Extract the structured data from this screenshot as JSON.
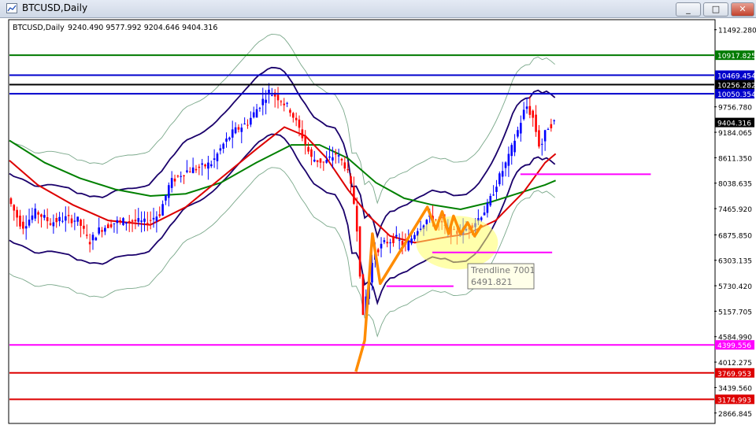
{
  "window": {
    "title": "BTCUSD,Daily",
    "buttons": [
      "_",
      "□",
      "✕"
    ]
  },
  "chart_data": {
    "type": "candlestick",
    "symbol_label": "BTCUSD,Daily",
    "ohlc_header": "9240.490 9577.992 9204.646 9404.316",
    "ohlc": {
      "open": 9240.49,
      "high": 9577.992,
      "low": 9204.646,
      "close": 9404.316
    },
    "last_price": 9404.316,
    "ylim": [
      2650,
      11700
    ],
    "y_ticks": [
      "11492.280",
      "9756.780",
      "9184.065",
      "8611.350",
      "8038.635",
      "7465.920",
      "6875.850",
      "6303.135",
      "5730.420",
      "5157.705",
      "4584.990",
      "4012.275",
      "3439.560",
      "2866.845"
    ],
    "horizontal_levels": [
      {
        "label": "10917.825",
        "value": 10917.825,
        "color": "#007a00"
      },
      {
        "label": "10469.454",
        "value": 10469.454,
        "color": "#0000cc"
      },
      {
        "label": "10256.282",
        "value": 10256.282,
        "color": "#000000"
      },
      {
        "label": "10050.354",
        "value": 10050.354,
        "color": "#0000cc"
      },
      {
        "label": "4399.556",
        "value": 4399.556,
        "color": "#ff00ff"
      },
      {
        "label": "3769.953",
        "value": 3769.953,
        "color": "#dd0000"
      },
      {
        "label": "3174.993",
        "value": 3174.993,
        "color": "#dd0000"
      }
    ],
    "support_lines": [
      {
        "value": 8240,
        "color": "#ff00ff",
        "x_from": 0.725,
        "x_to": 0.91
      },
      {
        "value": 6480,
        "color": "#ff00ff",
        "x_from": 0.6,
        "x_to": 0.77
      },
      {
        "value": 5720,
        "color": "#ff00ff",
        "x_from": 0.535,
        "x_to": 0.63
      }
    ],
    "tooltip": {
      "line1": "Trendline 7001",
      "line2": "6491.821"
    },
    "colors": {
      "bull": "#0000ff",
      "bear": "#ff0000",
      "ma_fast": "#dd0000",
      "ma_slow": "#008000",
      "bands_inner": "#1a006b",
      "bands_outer": "#7aa88a",
      "zigzag": "#ff8c00",
      "highlight": "#ffff66"
    },
    "price_path": [
      [
        0.0,
        7700
      ],
      [
        0.02,
        7050
      ],
      [
        0.04,
        7400
      ],
      [
        0.06,
        7150
      ],
      [
        0.08,
        7250
      ],
      [
        0.1,
        7200
      ],
      [
        0.115,
        6700
      ],
      [
        0.13,
        7000
      ],
      [
        0.15,
        7150
      ],
      [
        0.17,
        7200
      ],
      [
        0.195,
        7150
      ],
      [
        0.215,
        7350
      ],
      [
        0.23,
        8050
      ],
      [
        0.25,
        8300
      ],
      [
        0.275,
        8400
      ],
      [
        0.29,
        8500
      ],
      [
        0.305,
        8900
      ],
      [
        0.32,
        9200
      ],
      [
        0.34,
        9400
      ],
      [
        0.355,
        9750
      ],
      [
        0.37,
        10100
      ],
      [
        0.385,
        9950
      ],
      [
        0.4,
        9700
      ],
      [
        0.415,
        9200
      ],
      [
        0.43,
        8600
      ],
      [
        0.45,
        8500
      ],
      [
        0.465,
        8700
      ],
      [
        0.48,
        8400
      ],
      [
        0.49,
        7700
      ],
      [
        0.497,
        6800
      ],
      [
        0.503,
        4900
      ],
      [
        0.51,
        5700
      ],
      [
        0.52,
        6500
      ],
      [
        0.535,
        6700
      ],
      [
        0.55,
        6800
      ],
      [
        0.565,
        6600
      ],
      [
        0.58,
        7000
      ],
      [
        0.6,
        7300
      ],
      [
        0.615,
        7100
      ],
      [
        0.63,
        6900
      ],
      [
        0.65,
        7000
      ],
      [
        0.665,
        7200
      ],
      [
        0.68,
        7500
      ],
      [
        0.695,
        8100
      ],
      [
        0.71,
        8600
      ],
      [
        0.725,
        9300
      ],
      [
        0.735,
        9800
      ],
      [
        0.745,
        9500
      ],
      [
        0.755,
        8800
      ],
      [
        0.765,
        9300
      ],
      [
        0.775,
        9404
      ]
    ],
    "ma_fast_path": [
      [
        0.0,
        8550
      ],
      [
        0.04,
        8000
      ],
      [
        0.09,
        7550
      ],
      [
        0.14,
        7200
      ],
      [
        0.2,
        7100
      ],
      [
        0.25,
        7500
      ],
      [
        0.3,
        8150
      ],
      [
        0.35,
        8800
      ],
      [
        0.39,
        9300
      ],
      [
        0.42,
        9100
      ],
      [
        0.45,
        8600
      ],
      [
        0.48,
        7900
      ],
      [
        0.51,
        7300
      ],
      [
        0.54,
        6850
      ],
      [
        0.575,
        6700
      ],
      [
        0.61,
        6800
      ],
      [
        0.65,
        6900
      ],
      [
        0.69,
        7200
      ],
      [
        0.73,
        7850
      ],
      [
        0.76,
        8500
      ],
      [
        0.775,
        8700
      ]
    ],
    "ma_slow_path": [
      [
        0.0,
        9000
      ],
      [
        0.05,
        8500
      ],
      [
        0.1,
        8150
      ],
      [
        0.15,
        7900
      ],
      [
        0.2,
        7750
      ],
      [
        0.25,
        7800
      ],
      [
        0.3,
        8050
      ],
      [
        0.35,
        8500
      ],
      [
        0.4,
        8900
      ],
      [
        0.44,
        8900
      ],
      [
        0.48,
        8600
      ],
      [
        0.52,
        8050
      ],
      [
        0.56,
        7700
      ],
      [
        0.6,
        7550
      ],
      [
        0.64,
        7450
      ],
      [
        0.68,
        7600
      ],
      [
        0.72,
        7800
      ],
      [
        0.76,
        8000
      ],
      [
        0.775,
        8100
      ]
    ],
    "zigzag_path": [
      [
        0.4915,
        3800
      ],
      [
        0.504,
        4500
      ],
      [
        0.515,
        6900
      ],
      [
        0.526,
        5780
      ],
      [
        0.593,
        7500
      ],
      [
        0.605,
        7000
      ],
      [
        0.614,
        7400
      ],
      [
        0.623,
        6900
      ],
      [
        0.63,
        7300
      ],
      [
        0.64,
        6900
      ],
      [
        0.65,
        7150
      ],
      [
        0.66,
        6850
      ],
      [
        0.67,
        7100
      ]
    ]
  }
}
